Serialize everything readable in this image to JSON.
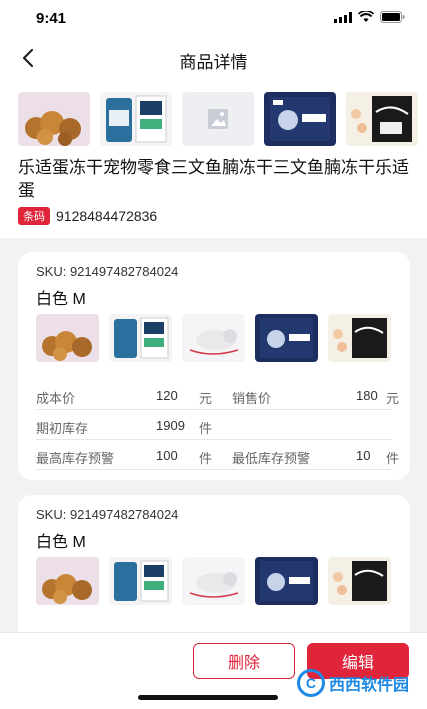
{
  "status": {
    "time": "9:41"
  },
  "nav": {
    "title": "商品详情"
  },
  "product": {
    "images": [
      "product-photo-freeze-dried-chunks",
      "product-photo-96-bag",
      "image-placeholder",
      "product-photo-blue-box",
      "product-photo-freshly-package"
    ],
    "title": "乐适蛋冻干宠物零食三文鱼腩冻干三文鱼腩冻干乐适蛋",
    "barcode_label": "条码",
    "barcode": "9128484472836"
  },
  "skus": [
    {
      "sku_line": "SKU: 921497482784024",
      "variant": "白色 M",
      "images": [
        "freeze-dried-chunks",
        "96-bag",
        "cat-with-toy",
        "blue-box",
        "freshly-package"
      ],
      "cost_label": "成本价",
      "cost_value": "120",
      "cost_unit": "元",
      "sale_label": "销售价",
      "sale_value": "180",
      "sale_unit": "元",
      "init_stock_label": "期初库存",
      "init_stock_value": "1909",
      "init_stock_unit": "件",
      "max_warn_label": "最高库存预警",
      "max_warn_value": "100",
      "max_warn_unit": "件",
      "min_warn_label": "最低库存预警",
      "min_warn_value": "10",
      "min_warn_unit": "件"
    },
    {
      "sku_line": "SKU: 921497482784024",
      "variant": "白色 M",
      "images": [
        "freeze-dried-chunks",
        "96-bag",
        "cat-with-toy",
        "blue-box",
        "freshly-package"
      ]
    }
  ],
  "actions": {
    "delete_label": "删除",
    "edit_label": "编辑"
  },
  "watermark": {
    "text": "西西软件园"
  },
  "colors": {
    "accent": "#e0243a",
    "background": "#f2f2f4"
  }
}
